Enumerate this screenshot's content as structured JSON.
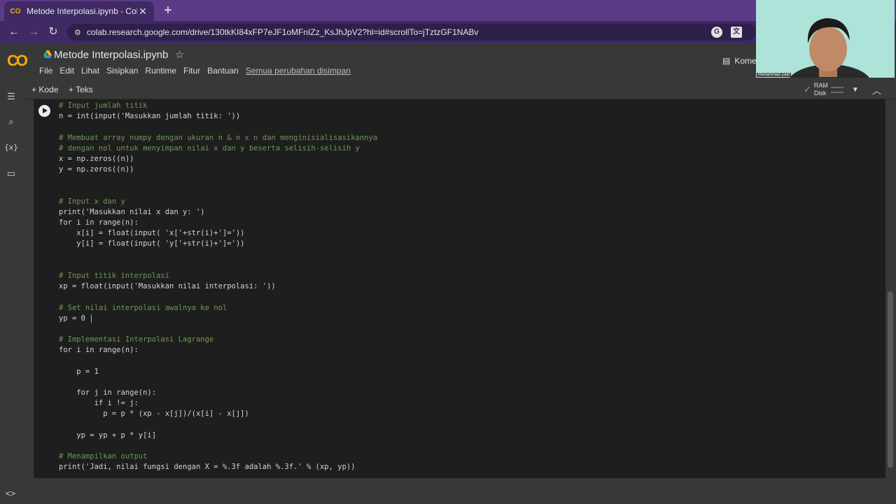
{
  "browser": {
    "tab_title": "Metode Interpolasi.ipynb - Colab",
    "tab_close": "✕",
    "new_tab": "+",
    "url": "colab.research.google.com/drive/130tkKI84xFP7eJF1oMFnIZz_KsJhJpV2?hl=id#scrollTo=jTztzGF1NABv"
  },
  "colab": {
    "notebook_title": "Metode Interpolasi.ipynb",
    "menu": [
      "File",
      "Edit",
      "Lihat",
      "Sisipkan",
      "Runtime",
      "Fitur",
      "Bantuan"
    ],
    "saved_status": "Semua perubahan disimpan",
    "comment_label": "Kome"
  },
  "toolbar": {
    "add_code": "+ Kode",
    "add_text": "+ Teks",
    "ram_label": "RAM",
    "disk_label": "Disk"
  },
  "webcam": {
    "name_label": "Muhammad Zaid"
  },
  "code_lines": [
    "# Input jumlah titik",
    "n = int(input('Masukkan jumlah titik: '))",
    "",
    "# Membuat array numpy dengan ukuran n & n x n dan menginisialisasikannya",
    "# dengan nol untuk menyimpan nilai x dan y beserta selisih-selisih y",
    "x = np.zeros((n))",
    "y = np.zeros((n))",
    "",
    "",
    "# Input x dan y",
    "print('Masukkan nilai x dan y: ')",
    "for i in range(n):",
    "    x[i] = float(input( 'x['+str(i)+']='))",
    "    y[i] = float(input( 'y['+str(i)+']='))",
    "",
    "",
    "# Input titik interpolasi",
    "xp = float(input('Masukkan nilai interpolasi: '))",
    "",
    "# Set nilai interpolasi awalnya ke nol",
    "yp = 0",
    "",
    "# Implementasi Interpolasi Lagrange",
    "for i in range(n):",
    "",
    "    p = 1",
    "",
    "    for j in range(n):",
    "        if i != j:",
    "          p = p * (xp - x[j])/(x[i] - x[j])",
    "",
    "    yp = yp + p * y[i]",
    "",
    "# Menampilkan output",
    "print('Jadi, nilai fungsi dengan X = %.3f adalah %.3f.' % (xp, yp))"
  ]
}
